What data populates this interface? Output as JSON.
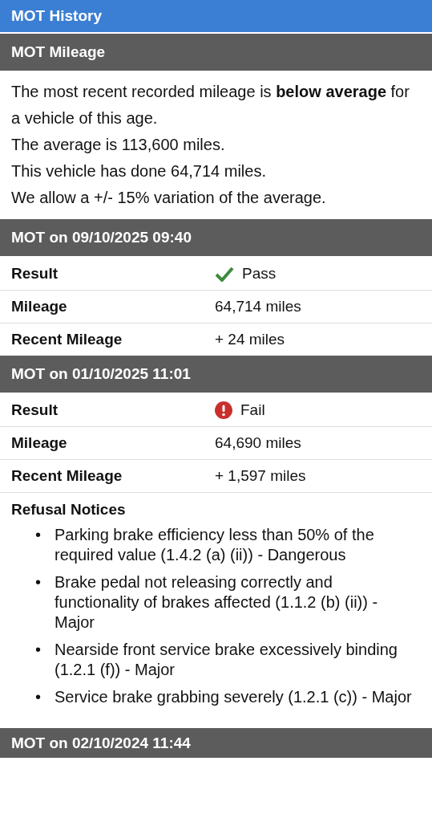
{
  "title": "MOT History",
  "mileage": {
    "heading": "MOT Mileage",
    "lines": [
      "The most recent recorded mileage is **below average** for a vehicle of this age.",
      "The average is 113,600 miles.",
      "This vehicle has done 64,714 miles.",
      "We allow a +/- 15% variation of the average."
    ]
  },
  "tests": [
    {
      "heading": "MOT on 09/10/2025 09:40",
      "rows": [
        {
          "label": "Result",
          "value": "Pass",
          "kind": "pass"
        },
        {
          "label": "Mileage",
          "value": "64,714 miles"
        },
        {
          "label": "Recent Mileage",
          "value": "+ 24 miles"
        }
      ]
    },
    {
      "heading": "MOT on 01/10/2025 11:01",
      "rows": [
        {
          "label": "Result",
          "value": "Fail",
          "kind": "fail"
        },
        {
          "label": "Mileage",
          "value": "64,690 miles"
        },
        {
          "label": "Recent Mileage",
          "value": "+ 1,597 miles"
        }
      ],
      "notices": {
        "heading": "Refusal Notices",
        "items": [
          {
            "marker": "•",
            "text": "Parking brake efficiency less than 50% of the required value (1.4.2 (a) (ii)) - Dangerous"
          },
          {
            "marker": "•",
            "text": "Brake pedal not releasing correctly and functionality of brakes affected (1.1.2 (b) (ii)) - Major"
          },
          {
            "marker": "•",
            "text": "Nearside front service brake excessively binding (1.2.1 (f)) - Major"
          },
          {
            "marker": "•",
            "text": "Service brake grabbing severely (1.2.1 (c)) - Major"
          }
        ]
      }
    },
    {
      "heading": "MOT on 02/10/2024 11:44"
    }
  ]
}
